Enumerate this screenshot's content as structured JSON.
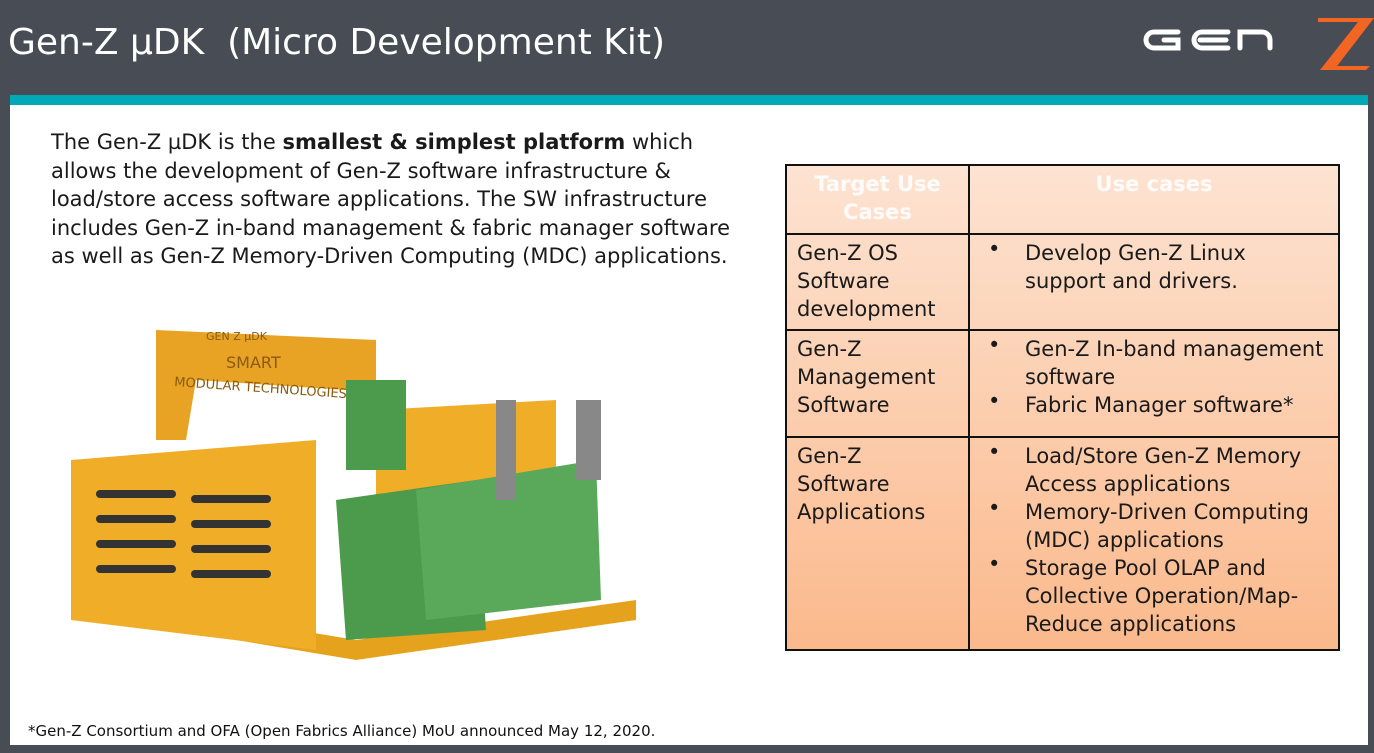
{
  "header": {
    "title": "Gen-Z µDK  (Micro Development Kit)",
    "logo_text": "GEN Z"
  },
  "colors": {
    "header_bg": "#474c55",
    "accent_teal": "#00a9b5",
    "logo_orange": "#f26522"
  },
  "intro": {
    "pre": "The Gen-Z µDK is the ",
    "bold": "smallest & simplest platform",
    "post": " which allows the development of Gen-Z software infrastructure & load/store access software applications. The SW infrastructure includes Gen-Z in-band management & fabric manager software as well as Gen-Z Memory-Driven Computing (MDC) applications."
  },
  "photo": {
    "label_line1": "SMART",
    "label_line2": "MODULAR TECHNOLOGIES",
    "label_top": "GEN Z µDK"
  },
  "table": {
    "headers": [
      "Target Use Cases",
      "Use cases"
    ],
    "rows": [
      {
        "target": "Gen-Z OS Software development",
        "cases": [
          "Develop Gen-Z Linux support and drivers."
        ]
      },
      {
        "target": "Gen-Z Management Software",
        "cases": [
          "Gen-Z In-band management software",
          "Fabric Manager software*"
        ]
      },
      {
        "target": "Gen-Z Software Applications",
        "cases": [
          "Load/Store Gen-Z Memory Access applications",
          "Memory-Driven Computing (MDC) applications",
          "Storage Pool OLAP and Collective Operation/Map-Reduce applications"
        ]
      }
    ]
  },
  "footnote": "*Gen-Z Consortium and OFA (Open Fabrics Alliance) MoU announced May 12, 2020."
}
